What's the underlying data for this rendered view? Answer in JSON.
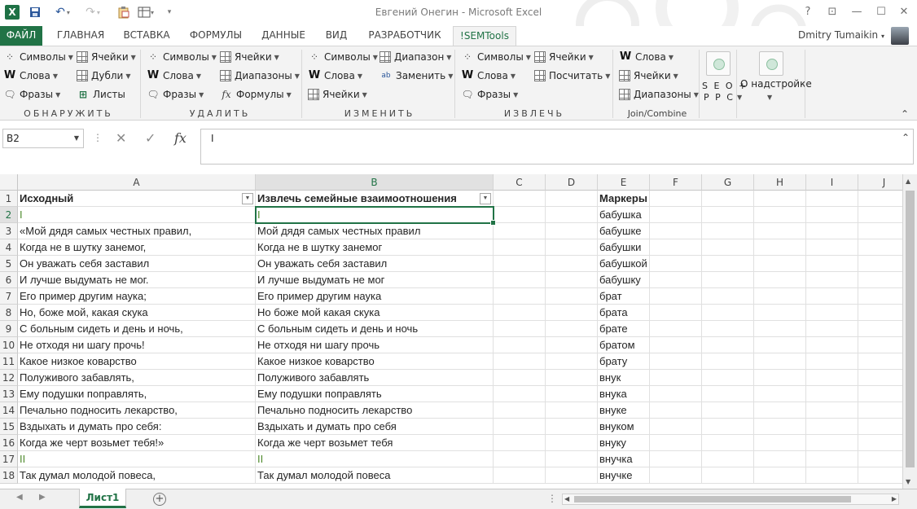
{
  "window": {
    "title": "Евгений Онегин - Microsoft Excel",
    "user": "Dmitry Tumaikin"
  },
  "tabs": [
    "ФАЙЛ",
    "ГЛАВНАЯ",
    "ВСТАВКА",
    "ФОРМУЛЫ",
    "ДАННЫЕ",
    "ВИД",
    "РАЗРАБОТЧИК",
    "!SEMTools"
  ],
  "ribbon": {
    "detect": {
      "label": "ОБНАРУЖИТЬ",
      "symbols": "Символы",
      "words": "Слова",
      "phrases": "Фразы",
      "cells": "Ячейки",
      "dupes": "Дубли",
      "sheets": "Листы"
    },
    "remove": {
      "label": "УДАЛИТЬ",
      "symbols": "Символы",
      "words": "Слова",
      "phrases": "Фразы",
      "cells": "Ячейки",
      "ranges": "Диапазоны",
      "formulas": "Формулы"
    },
    "change": {
      "label": "ИЗМЕНИТЬ",
      "symbols": "Символы",
      "words": "Слова",
      "cells": "Ячейки",
      "range": "Диапазон",
      "replace": "Заменить"
    },
    "extract": {
      "label": "ИЗВЛЕЧЬ",
      "symbols": "Символы",
      "words": "Слова",
      "phrases": "Фразы",
      "cells": "Ячейки",
      "count": "Посчитать"
    },
    "join": {
      "label": "Join/Combine",
      "words": "Слова",
      "cells": "Ячейки",
      "ranges": "Диапазоны"
    },
    "seo": {
      "line1": "S E O +",
      "line2": "P P C"
    },
    "about": "О надстройке"
  },
  "formula_bar": {
    "name_box": "B2",
    "fx": "fx",
    "value": "I"
  },
  "columns": [
    "A",
    "B",
    "C",
    "D",
    "E",
    "F",
    "G",
    "H",
    "I",
    "J"
  ],
  "rows": [
    {
      "n": "1",
      "a": "Исходный",
      "b": "Извлечь семейные взаимоотношения",
      "e": "Маркеры"
    },
    {
      "n": "2",
      "a": "I",
      "b": "I",
      "e": "бабушка"
    },
    {
      "n": "3",
      "a": "«Мой дядя самых честных правил,",
      "b": "Мой дядя самых честных правил",
      "e": "бабушке"
    },
    {
      "n": "4",
      "a": "Когда не в шутку занемог,",
      "b": "Когда не в шутку занемог",
      "e": "бабушки"
    },
    {
      "n": "5",
      "a": "Он уважать себя заставил",
      "b": "Он уважать себя заставил",
      "e": "бабушкой"
    },
    {
      "n": "6",
      "a": "И лучше выдумать не мог.",
      "b": "И лучше выдумать не мог",
      "e": "бабушку"
    },
    {
      "n": "7",
      "a": "Его пример другим наука;",
      "b": "Его пример другим наука",
      "e": "брат"
    },
    {
      "n": "8",
      "a": "Но, боже мой, какая скука",
      "b": "Но боже мой какая скука",
      "e": "брата"
    },
    {
      "n": "9",
      "a": "С больным сидеть и день и ночь,",
      "b": "С больным сидеть и день и ночь",
      "e": "брате"
    },
    {
      "n": "10",
      "a": "Не отходя ни шагу прочь!",
      "b": "Не отходя ни шагу прочь",
      "e": "братом"
    },
    {
      "n": "11",
      "a": "Какое низкое коварство",
      "b": "Какое низкое коварство",
      "e": "брату"
    },
    {
      "n": "12",
      "a": "Полуживого забавлять,",
      "b": "Полуживого забавлять",
      "e": "внук"
    },
    {
      "n": "13",
      "a": "Ему подушки поправлять,",
      "b": "Ему подушки поправлять",
      "e": "внука"
    },
    {
      "n": "14",
      "a": "Печально подносить лекарство,",
      "b": "Печально подносить лекарство",
      "e": "внуке"
    },
    {
      "n": "15",
      "a": "Вздыхать и думать про себя:",
      "b": "Вздыхать и думать про себя",
      "e": "внуком"
    },
    {
      "n": "16",
      "a": "Когда же черт возьмет тебя!»",
      "b": "Когда же черт возьмет тебя",
      "e": "внуку"
    },
    {
      "n": "17",
      "a": "II",
      "b": "II",
      "e": "внучка"
    },
    {
      "n": "18",
      "a": "Так думал молодой повеса,",
      "b": "Так думал молодой повеса",
      "e": "внучке"
    }
  ],
  "sheet_tab": "Лист1",
  "colors": {
    "accent": "#217346",
    "roman_numeral": "#4f8b2e"
  }
}
